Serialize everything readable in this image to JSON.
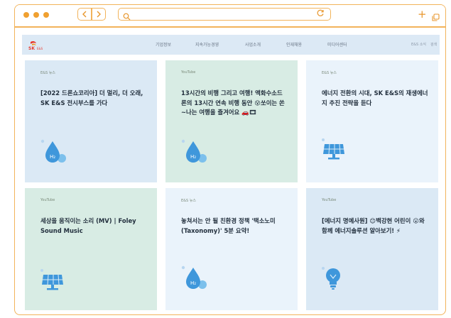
{
  "topbar": {
    "menu": [
      "기업정보",
      "지속가능경영",
      "사업소개",
      "인재채용",
      "미디어센터"
    ],
    "utility": "E&S 소식",
    "utility2": "검색"
  },
  "cards": [
    {
      "tag": "E&S 뉴스",
      "title": "[2022 드론쇼코리아] 더 멀리, 더 오래, SK E&S 전시부스를 가다",
      "icon": "hydrogen-drop-icon",
      "theme": "blue"
    },
    {
      "tag": "YouTube",
      "title": "13시간의 비행 그리고 여행! 액화수소드론의 13시간 연속 비행 동안 😵쏘이는 쏜~나는 여행을 즐겨어요 🚗🎞",
      "icon": "hydrogen-drop-icon",
      "theme": "green"
    },
    {
      "tag": "E&S 뉴스",
      "title": "에너지 전환의 시대, SK E&S의 재생에너지 추진 전략을 듣다",
      "icon": "solar-panel-icon",
      "theme": "pale"
    },
    {
      "tag": "YouTube",
      "title": "세상을 움직이는 소리 (MV) | Foley Sound Music",
      "icon": "solar-panel-icon",
      "theme": "green"
    },
    {
      "tag": "E&S 뉴스",
      "title": "놓쳐서는 안 될 친환경 정책 '택소노미(Taxonomy)' 5분 요약!",
      "icon": "hydrogen-drop-icon",
      "theme": "pale"
    },
    {
      "tag": "YouTube",
      "title": "[에너지 명예사원] 😊백강현 어린이 😮와 함께 에너지솔루션 알아보기! ⚡",
      "icon": "lightbulb-icon",
      "theme": "blue"
    }
  ],
  "colors": {
    "accent": "#f2b35a",
    "card_blue": "#dbe9f5",
    "card_green": "#d8ece4",
    "card_pale": "#eaf3fb",
    "icon_blue": "#4aa0de"
  }
}
